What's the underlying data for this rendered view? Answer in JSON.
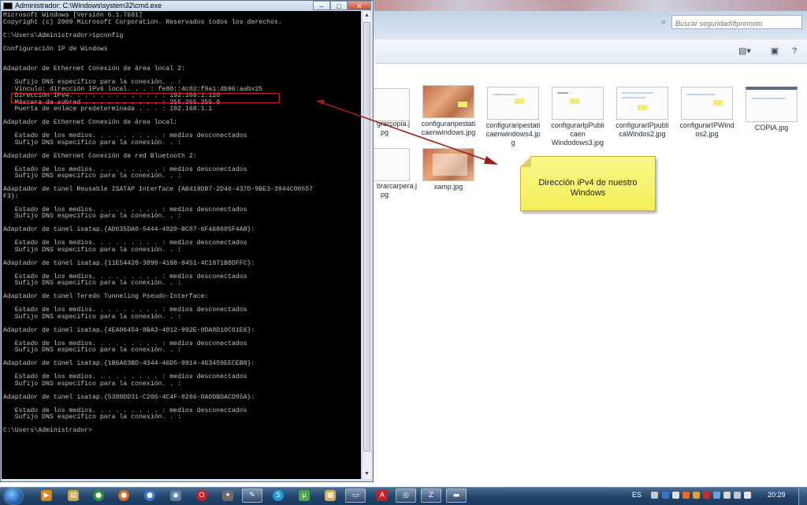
{
  "cmd_window": {
    "title": "Administrador: C:\\Windows\\system32\\cmd.exe",
    "minimize": "–",
    "maximize": "□",
    "close": "✕",
    "lines": [
      "Microsoft Windows [Versión 6.1.7601]",
      "Copyright (c) 2009 Microsoft Corporation. Reservados todos los derechos.",
      "",
      "C:\\Users\\Administrador>ipconfig",
      "",
      "Configuración IP de Windows",
      "",
      "",
      "Adaptador de Ethernet Conexión de área local 2:",
      "",
      "   Sufijo DNS específico para la conexión. . :",
      "   Vínculo: dirección IPv6 local. . . : fe80::4c02:f9a1:db96:aabx25",
      "   Dirección IPv4. . . . . . . . . . . . : 192.168.1.120",
      "   Máscara de subred . . . . . . . . . . : 255.255.255.0",
      "   Puerta de enlace predeterminada . . . : 192.168.1.1",
      "",
      "Adaptador de Ethernet Conexión de área local:",
      "",
      "   Estado de los medios. . . . . . . . . : medios desconectados",
      "   Sufijo DNS específico para la conexión. . :",
      "",
      "Adaptador de Ethernet Conexión de red Bluetooth 2:",
      "",
      "   Estado de los medios. . . . . . . . . : medios desconectados",
      "   Sufijo DNS específico para la conexión. . :",
      "",
      "Adaptador de túnel Reusable ISATAP Interface {AB419D87-2D40-437D-9BE3-3944C00557",
      "F3}:",
      "",
      "   Estado de los medios. . . . . . . . . : medios desconectados",
      "   Sufijo DNS específico para la conexión. . :",
      "",
      "Adaptador de túnel isatap.{AD635DA0-5444-4920-BC07-6F468605F4A8}:",
      "",
      "   Estado de los medios. . . . . . . . . : medios desconectados",
      "   Sufijo DNS específico para la conexión. . :",
      "",
      "Adaptador de túnel isatap.{11E54420-3898-4188-9451-4C1871B8DFFC}:",
      "",
      "   Estado de los medios. . . . . . . . . : medios desconectados",
      "   Sufijo DNS específico para la conexión. . :",
      "",
      "Adaptador de túnel Teredo Tunneling Pseudo-Interface:",
      "",
      "   Estado de los medios. . . . . . . . . : medios desconectados",
      "   Sufijo DNS específico para la conexión. . :",
      "",
      "Adaptador de túnel isatap.{4EA06454-8BA3-4012-992E-0DA8D10C61E6}:",
      "",
      "   Estado de los medios. . . . . . . . . : medios desconectados",
      "   Sufijo DNS específico para la conexión. . :",
      "",
      "Adaptador de túnel isatap.{1B6A03BD-4344-46D5-9914-463459EECEB8}:",
      "",
      "   Estado de los medios. . . . . . . . . : medios desconectados",
      "   Sufijo DNS específico para la conexión. . :",
      "",
      "Adaptador de túnel isatap.{5380DD31-C206-4C4F-8266-DA0DBDACD95A}:",
      "",
      "   Estado de los medios. . . . . . . . . : medios desconectados",
      "   Sufijo DNS específico para la conexión. . :",
      "",
      "C:\\Users\\Administrador>"
    ]
  },
  "explorer": {
    "search_placeholder": "Buscar seguridad\\ftpremoto",
    "view_icon": "view-options-icon",
    "preview_icon": "preview-pane-icon",
    "help_icon": "help-icon",
    "partial_captions": [
      "grarcopia.j",
      "pg",
      "brarcarpera.j",
      "pg"
    ],
    "thumbnails": [
      {
        "caption": "configuraripestati\ncaenwindows.jpg",
        "style": "warm"
      },
      {
        "caption": "configuraripestati\ncaenwindows4.jp\ng",
        "style": "doc"
      },
      {
        "caption": "configurarIpPubli\ncaen\nWindodows3.jpg",
        "style": "doc"
      },
      {
        "caption": "configurarIPpubli\ncaWindos2.jpg",
        "style": "doc"
      },
      {
        "caption": "configurarIPWind\nos2.jpg",
        "style": "doc"
      },
      {
        "caption": "COPIA.jpg",
        "style": "doc"
      },
      {
        "caption": "xamp.jpg",
        "style": "warm"
      }
    ]
  },
  "callout": {
    "text_line1": "Dirección iPv4 de nuestro",
    "text_line2": "Windows",
    "highlight_color": "#c0271d",
    "note_color": "#f6f26a"
  },
  "taskbar": {
    "language": "ES",
    "clock": "20:29",
    "pinned": [
      "media-player-icon",
      "libraries-icon",
      "chrome-icon",
      "firefox-icon",
      "chrome-alt-icon",
      "network-icon",
      "opera-icon",
      "gimp-icon",
      "notepad-icon",
      "skype-icon",
      "utorrent-icon",
      "explorer-icon",
      "acrobat-icon",
      "chrome-window-icon",
      "filezilla-icon",
      "cmd-icon"
    ]
  }
}
